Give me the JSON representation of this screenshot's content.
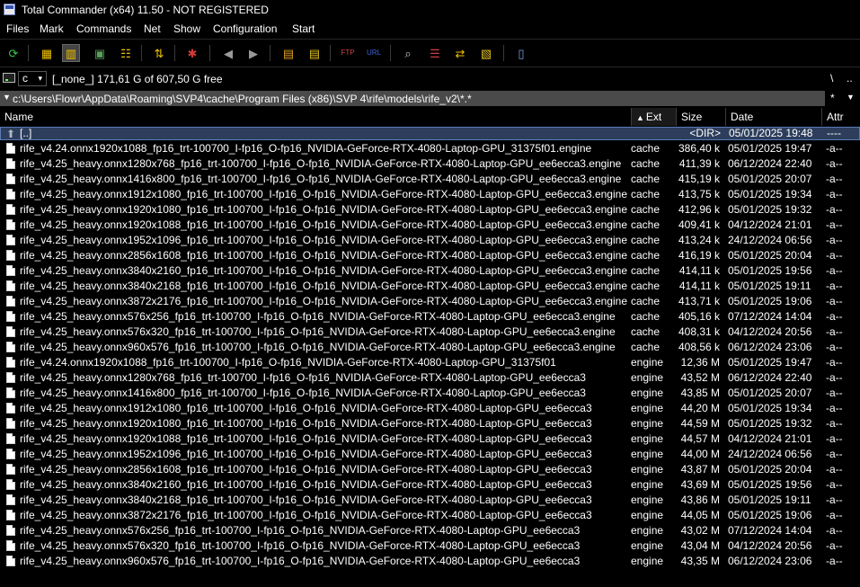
{
  "window": {
    "title": "Total Commander (x64) 11.50 - NOT REGISTERED"
  },
  "menu": [
    "Files",
    "Mark",
    "Commands",
    "Net",
    "Show",
    "Configuration",
    "Start"
  ],
  "toolbar": {
    "buttons": [
      {
        "icon": "refresh-icon"
      },
      {
        "icon": "brief-view-icon"
      },
      {
        "icon": "full-view-icon"
      },
      {
        "icon": "thumbnails-icon"
      },
      {
        "icon": "tree-view-icon"
      },
      {
        "icon": "invert-selection-icon"
      },
      {
        "icon": "unpack-all-icon"
      },
      {
        "icon": "back-icon"
      },
      {
        "icon": "forward-icon"
      },
      {
        "icon": "pack-files-icon"
      },
      {
        "icon": "unpack-files-icon"
      },
      {
        "icon": "ftp-connect-icon"
      },
      {
        "icon": "url-connect-icon"
      },
      {
        "icon": "search-icon"
      },
      {
        "icon": "multi-rename-icon"
      },
      {
        "icon": "synchronize-icon"
      },
      {
        "icon": "compare-icon"
      },
      {
        "icon": "notepad-icon"
      }
    ]
  },
  "drive": {
    "letter": "c",
    "volume": "[_none_]",
    "free_text": "171,61 G of 607,50 G free",
    "root_label": "\\",
    "up_label": ".."
  },
  "path": {
    "value": "c:\\Users\\Flowr\\AppData\\Roaming\\SVP4\\cache\\Program Files (x86)\\SVP 4\\rife\\models\\rife_v2\\*.*",
    "star_label": "*"
  },
  "columns": {
    "name": "Name",
    "ext": "Ext",
    "size": "Size",
    "date": "Date",
    "attr": "Attr"
  },
  "colors": {
    "background": "#000000",
    "path_bar": "#4a4a4a",
    "focused_row": "#2d3e5c"
  },
  "files": [
    {
      "name": "[..]",
      "ext": "",
      "size": "<DIR>",
      "date": "05/01/2025 19:48",
      "attr": "----",
      "type": "parent"
    },
    {
      "name": "rife_v4.24.onnx1920x1088_fp16_trt-100700_I-fp16_O-fp16_NVIDIA-GeForce-RTX-4080-Laptop-GPU_31375f01.engine",
      "ext": "cache",
      "size": "386,40 k",
      "date": "05/01/2025 19:47",
      "attr": "-a--",
      "type": "file"
    },
    {
      "name": "rife_v4.25_heavy.onnx1280x768_fp16_trt-100700_I-fp16_O-fp16_NVIDIA-GeForce-RTX-4080-Laptop-GPU_ee6ecca3.engine",
      "ext": "cache",
      "size": "411,39 k",
      "date": "06/12/2024 22:40",
      "attr": "-a--",
      "type": "file"
    },
    {
      "name": "rife_v4.25_heavy.onnx1416x800_fp16_trt-100700_I-fp16_O-fp16_NVIDIA-GeForce-RTX-4080-Laptop-GPU_ee6ecca3.engine",
      "ext": "cache",
      "size": "415,19 k",
      "date": "05/01/2025 20:07",
      "attr": "-a--",
      "type": "file"
    },
    {
      "name": "rife_v4.25_heavy.onnx1912x1080_fp16_trt-100700_I-fp16_O-fp16_NVIDIA-GeForce-RTX-4080-Laptop-GPU_ee6ecca3.engine",
      "ext": "cache",
      "size": "413,75 k",
      "date": "05/01/2025 19:34",
      "attr": "-a--",
      "type": "file"
    },
    {
      "name": "rife_v4.25_heavy.onnx1920x1080_fp16_trt-100700_I-fp16_O-fp16_NVIDIA-GeForce-RTX-4080-Laptop-GPU_ee6ecca3.engine",
      "ext": "cache",
      "size": "412,96 k",
      "date": "05/01/2025 19:32",
      "attr": "-a--",
      "type": "file"
    },
    {
      "name": "rife_v4.25_heavy.onnx1920x1088_fp16_trt-100700_I-fp16_O-fp16_NVIDIA-GeForce-RTX-4080-Laptop-GPU_ee6ecca3.engine",
      "ext": "cache",
      "size": "409,41 k",
      "date": "04/12/2024 21:01",
      "attr": "-a--",
      "type": "file"
    },
    {
      "name": "rife_v4.25_heavy.onnx1952x1096_fp16_trt-100700_I-fp16_O-fp16_NVIDIA-GeForce-RTX-4080-Laptop-GPU_ee6ecca3.engine",
      "ext": "cache",
      "size": "413,24 k",
      "date": "24/12/2024 06:56",
      "attr": "-a--",
      "type": "file"
    },
    {
      "name": "rife_v4.25_heavy.onnx2856x1608_fp16_trt-100700_I-fp16_O-fp16_NVIDIA-GeForce-RTX-4080-Laptop-GPU_ee6ecca3.engine",
      "ext": "cache",
      "size": "416,19 k",
      "date": "05/01/2025 20:04",
      "attr": "-a--",
      "type": "file"
    },
    {
      "name": "rife_v4.25_heavy.onnx3840x2160_fp16_trt-100700_I-fp16_O-fp16_NVIDIA-GeForce-RTX-4080-Laptop-GPU_ee6ecca3.engine",
      "ext": "cache",
      "size": "414,11 k",
      "date": "05/01/2025 19:56",
      "attr": "-a--",
      "type": "file"
    },
    {
      "name": "rife_v4.25_heavy.onnx3840x2168_fp16_trt-100700_I-fp16_O-fp16_NVIDIA-GeForce-RTX-4080-Laptop-GPU_ee6ecca3.engine",
      "ext": "cache",
      "size": "414,11 k",
      "date": "05/01/2025 19:11",
      "attr": "-a--",
      "type": "file"
    },
    {
      "name": "rife_v4.25_heavy.onnx3872x2176_fp16_trt-100700_I-fp16_O-fp16_NVIDIA-GeForce-RTX-4080-Laptop-GPU_ee6ecca3.engine",
      "ext": "cache",
      "size": "413,71 k",
      "date": "05/01/2025 19:06",
      "attr": "-a--",
      "type": "file"
    },
    {
      "name": "rife_v4.25_heavy.onnx576x256_fp16_trt-100700_I-fp16_O-fp16_NVIDIA-GeForce-RTX-4080-Laptop-GPU_ee6ecca3.engine",
      "ext": "cache",
      "size": "405,16 k",
      "date": "07/12/2024 14:04",
      "attr": "-a--",
      "type": "file"
    },
    {
      "name": "rife_v4.25_heavy.onnx576x320_fp16_trt-100700_I-fp16_O-fp16_NVIDIA-GeForce-RTX-4080-Laptop-GPU_ee6ecca3.engine",
      "ext": "cache",
      "size": "408,31 k",
      "date": "04/12/2024 20:56",
      "attr": "-a--",
      "type": "file"
    },
    {
      "name": "rife_v4.25_heavy.onnx960x576_fp16_trt-100700_I-fp16_O-fp16_NVIDIA-GeForce-RTX-4080-Laptop-GPU_ee6ecca3.engine",
      "ext": "cache",
      "size": "408,56 k",
      "date": "06/12/2024 23:06",
      "attr": "-a--",
      "type": "file"
    },
    {
      "name": "rife_v4.24.onnx1920x1088_fp16_trt-100700_I-fp16_O-fp16_NVIDIA-GeForce-RTX-4080-Laptop-GPU_31375f01",
      "ext": "engine",
      "size": "12,36 M",
      "date": "05/01/2025 19:47",
      "attr": "-a--",
      "type": "file"
    },
    {
      "name": "rife_v4.25_heavy.onnx1280x768_fp16_trt-100700_I-fp16_O-fp16_NVIDIA-GeForce-RTX-4080-Laptop-GPU_ee6ecca3",
      "ext": "engine",
      "size": "43,52 M",
      "date": "06/12/2024 22:40",
      "attr": "-a--",
      "type": "file"
    },
    {
      "name": "rife_v4.25_heavy.onnx1416x800_fp16_trt-100700_I-fp16_O-fp16_NVIDIA-GeForce-RTX-4080-Laptop-GPU_ee6ecca3",
      "ext": "engine",
      "size": "43,85 M",
      "date": "05/01/2025 20:07",
      "attr": "-a--",
      "type": "file"
    },
    {
      "name": "rife_v4.25_heavy.onnx1912x1080_fp16_trt-100700_I-fp16_O-fp16_NVIDIA-GeForce-RTX-4080-Laptop-GPU_ee6ecca3",
      "ext": "engine",
      "size": "44,20 M",
      "date": "05/01/2025 19:34",
      "attr": "-a--",
      "type": "file"
    },
    {
      "name": "rife_v4.25_heavy.onnx1920x1080_fp16_trt-100700_I-fp16_O-fp16_NVIDIA-GeForce-RTX-4080-Laptop-GPU_ee6ecca3",
      "ext": "engine",
      "size": "44,59 M",
      "date": "05/01/2025 19:32",
      "attr": "-a--",
      "type": "file"
    },
    {
      "name": "rife_v4.25_heavy.onnx1920x1088_fp16_trt-100700_I-fp16_O-fp16_NVIDIA-GeForce-RTX-4080-Laptop-GPU_ee6ecca3",
      "ext": "engine",
      "size": "44,57 M",
      "date": "04/12/2024 21:01",
      "attr": "-a--",
      "type": "file"
    },
    {
      "name": "rife_v4.25_heavy.onnx1952x1096_fp16_trt-100700_I-fp16_O-fp16_NVIDIA-GeForce-RTX-4080-Laptop-GPU_ee6ecca3",
      "ext": "engine",
      "size": "44,00 M",
      "date": "24/12/2024 06:56",
      "attr": "-a--",
      "type": "file"
    },
    {
      "name": "rife_v4.25_heavy.onnx2856x1608_fp16_trt-100700_I-fp16_O-fp16_NVIDIA-GeForce-RTX-4080-Laptop-GPU_ee6ecca3",
      "ext": "engine",
      "size": "43,87 M",
      "date": "05/01/2025 20:04",
      "attr": "-a--",
      "type": "file"
    },
    {
      "name": "rife_v4.25_heavy.onnx3840x2160_fp16_trt-100700_I-fp16_O-fp16_NVIDIA-GeForce-RTX-4080-Laptop-GPU_ee6ecca3",
      "ext": "engine",
      "size": "43,69 M",
      "date": "05/01/2025 19:56",
      "attr": "-a--",
      "type": "file"
    },
    {
      "name": "rife_v4.25_heavy.onnx3840x2168_fp16_trt-100700_I-fp16_O-fp16_NVIDIA-GeForce-RTX-4080-Laptop-GPU_ee6ecca3",
      "ext": "engine",
      "size": "43,86 M",
      "date": "05/01/2025 19:11",
      "attr": "-a--",
      "type": "file"
    },
    {
      "name": "rife_v4.25_heavy.onnx3872x2176_fp16_trt-100700_I-fp16_O-fp16_NVIDIA-GeForce-RTX-4080-Laptop-GPU_ee6ecca3",
      "ext": "engine",
      "size": "44,05 M",
      "date": "05/01/2025 19:06",
      "attr": "-a--",
      "type": "file"
    },
    {
      "name": "rife_v4.25_heavy.onnx576x256_fp16_trt-100700_I-fp16_O-fp16_NVIDIA-GeForce-RTX-4080-Laptop-GPU_ee6ecca3",
      "ext": "engine",
      "size": "43,02 M",
      "date": "07/12/2024 14:04",
      "attr": "-a--",
      "type": "file"
    },
    {
      "name": "rife_v4.25_heavy.onnx576x320_fp16_trt-100700_I-fp16_O-fp16_NVIDIA-GeForce-RTX-4080-Laptop-GPU_ee6ecca3",
      "ext": "engine",
      "size": "43,04 M",
      "date": "04/12/2024 20:56",
      "attr": "-a--",
      "type": "file"
    },
    {
      "name": "rife_v4.25_heavy.onnx960x576_fp16_trt-100700_I-fp16_O-fp16_NVIDIA-GeForce-RTX-4080-Laptop-GPU_ee6ecca3",
      "ext": "engine",
      "size": "43,35 M",
      "date": "06/12/2024 23:06",
      "attr": "-a--",
      "type": "file"
    }
  ]
}
